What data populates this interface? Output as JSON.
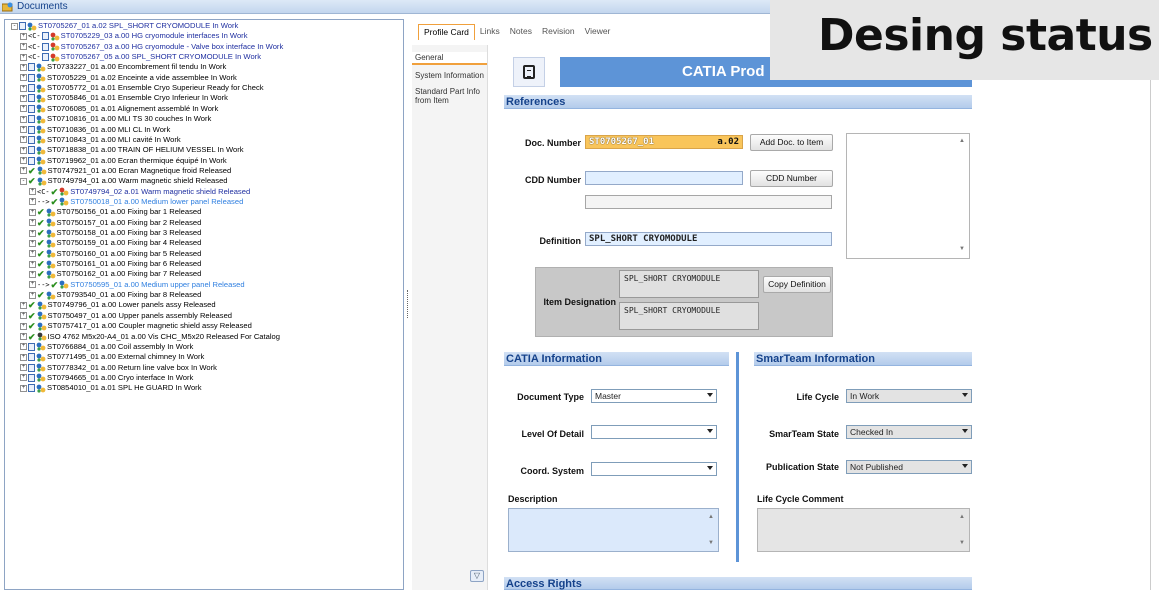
{
  "window": {
    "title": "Documents"
  },
  "overlay_title": "Desing status",
  "tree": [
    {
      "label": "ST0705267_01 a.02 SPL_SHORT CRYOMODULE In Work",
      "depth": 0,
      "exp": "-",
      "icons": [
        "doc",
        "cat"
      ],
      "style": "blue"
    },
    {
      "label": "ST0705229_03 a.00 HG cryomodule interfaces In Work",
      "depth": 1,
      "exp": "+",
      "icons": [
        "con",
        "doc",
        "prod"
      ],
      "style": "blue"
    },
    {
      "label": "ST0705267_03 a.00 HG cryomodule - Valve box interface In Work",
      "depth": 1,
      "exp": "+",
      "icons": [
        "con",
        "doc",
        "prod"
      ],
      "style": "blue"
    },
    {
      "label": "ST0705267_05 a.00 SPL_SHORT CRYOMODULE In Work",
      "depth": 1,
      "exp": "+",
      "icons": [
        "con",
        "doc",
        "prod"
      ],
      "style": "blue"
    },
    {
      "label": "ST0733227_01 a.00 Encombrement fil tendu In Work",
      "depth": 1,
      "exp": "+",
      "icons": [
        "doc",
        "cat"
      ],
      "style": ""
    },
    {
      "label": "ST0705229_01 a.02 Enceinte a vide assemblee In Work",
      "depth": 1,
      "exp": "+",
      "icons": [
        "doc",
        "cat"
      ],
      "style": ""
    },
    {
      "label": "ST0705772_01 a.01 Ensemble Cryo Superieur Ready for Check",
      "depth": 1,
      "exp": "+",
      "icons": [
        "doc",
        "cat"
      ],
      "style": ""
    },
    {
      "label": "ST0705846_01 a.01 Ensemble Cryo Inferieur In Work",
      "depth": 1,
      "exp": "+",
      "icons": [
        "doc",
        "cat"
      ],
      "style": ""
    },
    {
      "label": "ST0706085_01 a.01  Alignement assemblé In Work",
      "depth": 1,
      "exp": "+",
      "icons": [
        "doc",
        "cat"
      ],
      "style": ""
    },
    {
      "label": "ST0710816_01 a.00 MLI TS 30 couches In Work",
      "depth": 1,
      "exp": "+",
      "icons": [
        "doc",
        "cat"
      ],
      "style": ""
    },
    {
      "label": "ST0710836_01 a.00 MLI CL In Work",
      "depth": 1,
      "exp": "+",
      "icons": [
        "doc",
        "cat"
      ],
      "style": ""
    },
    {
      "label": "ST0710843_01 a.00 MLI cavité In Work",
      "depth": 1,
      "exp": "+",
      "icons": [
        "doc",
        "cat"
      ],
      "style": ""
    },
    {
      "label": "ST0718838_01 a.00 TRAIN OF HELIUM VESSEL In Work",
      "depth": 1,
      "exp": "+",
      "icons": [
        "doc",
        "cat"
      ],
      "style": ""
    },
    {
      "label": "ST0719962_01 a.00 Ecran thermique équipé In Work",
      "depth": 1,
      "exp": "+",
      "icons": [
        "doc",
        "cat"
      ],
      "style": ""
    },
    {
      "label": "ST0747921_01 a.00 Ecran Magnetique froid Released",
      "depth": 1,
      "exp": "+",
      "icons": [
        "chk",
        "cat"
      ],
      "style": ""
    },
    {
      "label": "ST0749794_01 a.00 Warm magnetic shield Released",
      "depth": 1,
      "exp": "-",
      "icons": [
        "chk",
        "cat"
      ],
      "style": ""
    },
    {
      "label": "ST0749794_02 a.01 Warm magnetic shield Released",
      "depth": 2,
      "exp": "+",
      "icons": [
        "con",
        "chk",
        "prod"
      ],
      "style": "blue"
    },
    {
      "label": "ST0750018_01 a.00 Medium lower panel Released",
      "depth": 2,
      "exp": "+",
      "icons": [
        "arr",
        "chk",
        "cat"
      ],
      "style": "link"
    },
    {
      "label": "ST0750156_01 a.00 Fixing bar 1 Released",
      "depth": 2,
      "exp": "+",
      "icons": [
        "chk",
        "cat"
      ],
      "style": ""
    },
    {
      "label": "ST0750157_01 a.00 Fixing bar 2 Released",
      "depth": 2,
      "exp": "+",
      "icons": [
        "chk",
        "cat"
      ],
      "style": ""
    },
    {
      "label": "ST0750158_01 a.00 Fixing bar 3 Released",
      "depth": 2,
      "exp": "+",
      "icons": [
        "chk",
        "cat"
      ],
      "style": ""
    },
    {
      "label": "ST0750159_01 a.00 Fixing bar 4 Released",
      "depth": 2,
      "exp": "+",
      "icons": [
        "chk",
        "cat"
      ],
      "style": ""
    },
    {
      "label": "ST0750160_01 a.00 Fixing bar 5 Released",
      "depth": 2,
      "exp": "+",
      "icons": [
        "chk",
        "cat"
      ],
      "style": ""
    },
    {
      "label": "ST0750161_01 a.00 Fixing bar 6 Released",
      "depth": 2,
      "exp": "+",
      "icons": [
        "chk",
        "cat"
      ],
      "style": ""
    },
    {
      "label": "ST0750162_01 a.00 Fixing bar 7 Released",
      "depth": 2,
      "exp": "+",
      "icons": [
        "chk",
        "cat"
      ],
      "style": ""
    },
    {
      "label": "ST0750595_01 a.00 Medium upper panel Released",
      "depth": 2,
      "exp": "+",
      "icons": [
        "arr",
        "chk",
        "cat"
      ],
      "style": "link"
    },
    {
      "label": "ST0793540_01 a.00 Fixing bar 8 Released",
      "depth": 2,
      "exp": "+",
      "icons": [
        "chk",
        "cat"
      ],
      "style": ""
    },
    {
      "label": "ST0749796_01 a.00 Lower panels assy Released",
      "depth": 1,
      "exp": "+",
      "icons": [
        "chk",
        "cat"
      ],
      "style": ""
    },
    {
      "label": "ST0750497_01 a.00 Upper panels assembly Released",
      "depth": 1,
      "exp": "+",
      "icons": [
        "chk",
        "cat"
      ],
      "style": ""
    },
    {
      "label": "ST0757417_01 a.00 Coupler magnetic shield assy Released",
      "depth": 1,
      "exp": "+",
      "icons": [
        "chk",
        "cat"
      ],
      "style": ""
    },
    {
      "label": "ISO 4762 M5x20-A4_01 a.00 Vis CHC_M5x20 Released For Catalog",
      "depth": 1,
      "exp": "+",
      "icons": [
        "chk",
        "part"
      ],
      "style": ""
    },
    {
      "label": "ST0766884_01 a.00 Coil assembly In Work",
      "depth": 1,
      "exp": "+",
      "icons": [
        "doc",
        "cat"
      ],
      "style": ""
    },
    {
      "label": "ST0771495_01 a.00 External chimney In Work",
      "depth": 1,
      "exp": "+",
      "icons": [
        "doc",
        "cat"
      ],
      "style": ""
    },
    {
      "label": "ST0778342_01 a.00 Return line valve box In Work",
      "depth": 1,
      "exp": "+",
      "icons": [
        "doc",
        "cat"
      ],
      "style": ""
    },
    {
      "label": "ST0794665_01 a.00 Cryo interface In Work",
      "depth": 1,
      "exp": "+",
      "icons": [
        "doc",
        "cat"
      ],
      "style": ""
    },
    {
      "label": "ST0854010_01 a.01 SPL He GUARD In Work",
      "depth": 1,
      "exp": "+",
      "icons": [
        "doc",
        "cat"
      ],
      "style": ""
    }
  ],
  "tabs": [
    {
      "label": "Profile Card",
      "active": true
    },
    {
      "label": "Links",
      "active": false
    },
    {
      "label": "Notes",
      "active": false
    },
    {
      "label": "Revision",
      "active": false
    },
    {
      "label": "Viewer",
      "active": false
    }
  ],
  "nav": [
    {
      "label": "General",
      "active": true
    },
    {
      "label": "System Information",
      "active": false
    },
    {
      "label": "Standard Part Info from Item",
      "active": false
    }
  ],
  "header": {
    "title": "CATIA Prod"
  },
  "references": {
    "section": "References",
    "doc_number_label": "Doc. Number",
    "doc_number": "ST0705267_01",
    "revision": "a.02",
    "add_doc_button": "Add Doc. to Item",
    "cdd_label": "CDD Number",
    "cdd_value": "",
    "cdd_button": "CDD Number",
    "definition_label": "Definition",
    "definition": "SPL_SHORT CRYOMODULE",
    "item_designation_label": "Item Designation",
    "item_designation_1": "SPL_SHORT CRYOMODULE",
    "item_designation_2": "SPL_SHORT CRYOMODULE",
    "copy_definition_button": "Copy Definition"
  },
  "catia": {
    "section": "CATIA Information",
    "doc_type_label": "Document Type",
    "doc_type": "Master",
    "lod_label": "Level Of Detail",
    "lod": "",
    "coord_label": "Coord. System",
    "coord": "",
    "description_label": "Description"
  },
  "smarteam": {
    "section": "SmarTeam Information",
    "lifecycle_label": "Life Cycle",
    "lifecycle": "In Work",
    "state_label": "SmarTeam State",
    "state": "Checked In",
    "pubstate_label": "Publication State",
    "pubstate": "Not Published",
    "comment_label": "Life Cycle Comment"
  },
  "access_rights": {
    "section": "Access Rights"
  },
  "colors": {
    "accent": "#5d94d7",
    "section_text": "#15428b",
    "highlight": "#f9c55b",
    "tab_active": "#f0a03c"
  }
}
